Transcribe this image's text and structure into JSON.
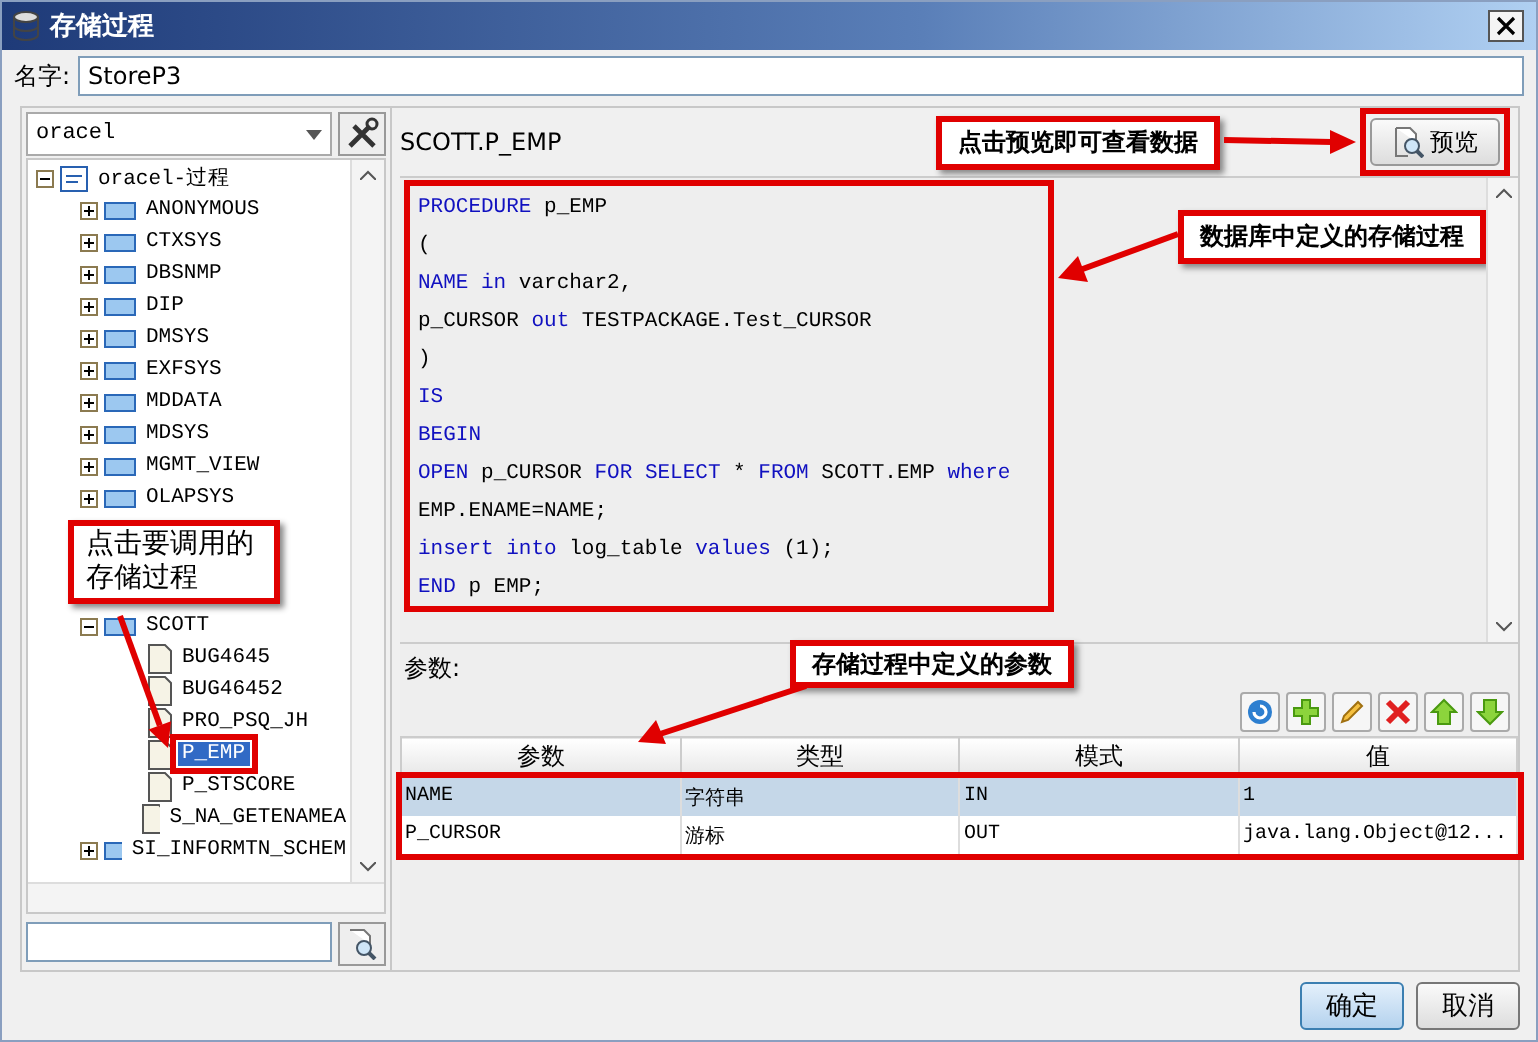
{
  "window": {
    "title": "存储过程"
  },
  "name_field": {
    "label": "名字:",
    "value": "StoreP3"
  },
  "connection_select": {
    "value": "oracel"
  },
  "tree": {
    "label": "oracel-过程",
    "expanded": true,
    "selected": false,
    "children": [
      {
        "kind": "schema",
        "label": "ANONYMOUS",
        "expanded": false,
        "selected": false
      },
      {
        "kind": "schema",
        "label": "CTXSYS",
        "expanded": false,
        "selected": false
      },
      {
        "kind": "schema",
        "label": "DBSNMP",
        "expanded": false,
        "selected": false
      },
      {
        "kind": "schema",
        "label": "DIP",
        "expanded": false,
        "selected": false
      },
      {
        "kind": "schema",
        "label": "DMSYS",
        "expanded": false,
        "selected": false
      },
      {
        "kind": "schema",
        "label": "EXFSYS",
        "expanded": false,
        "selected": false
      },
      {
        "kind": "schema",
        "label": "MDDATA",
        "expanded": false,
        "selected": false
      },
      {
        "kind": "schema",
        "label": "MDSYS",
        "expanded": false,
        "selected": false
      },
      {
        "kind": "schema",
        "label": "MGMT_VIEW",
        "expanded": false,
        "selected": false
      },
      {
        "kind": "schema",
        "label": "OLAPSYS",
        "expanded": false,
        "selected": false
      },
      {
        "kind": "note",
        "text": "点击要调用的存储过程"
      },
      {
        "kind": "schema",
        "label": "SCOTT",
        "expanded": true,
        "selected": false,
        "children": [
          {
            "kind": "procedure",
            "label": "BUG4645",
            "selected": false
          },
          {
            "kind": "procedure",
            "label": "BUG46452",
            "selected": false
          },
          {
            "kind": "procedure",
            "label": "PRO_PSQ_JH",
            "selected": false
          },
          {
            "kind": "procedure",
            "label": "P_EMP",
            "selected": true
          },
          {
            "kind": "procedure",
            "label": "P_STSCORE",
            "selected": false
          },
          {
            "kind": "procedure",
            "label": "S_NA_GETENAMEA",
            "selected": false
          }
        ]
      },
      {
        "kind": "schema",
        "label": "SI_INFORMTN_SCHEM",
        "expanded": false,
        "selected": false
      }
    ]
  },
  "procedure_header": {
    "title": "SCOTT.P_EMP",
    "note": "点击预览即可查看数据",
    "preview_button": "预览"
  },
  "code_note": "数据库中定义的存储过程",
  "code_lines": [
    [
      {
        "kind": "kw",
        "text": "PROCEDURE"
      },
      {
        "kind": "plain",
        "text": " p_EMP"
      }
    ],
    [
      {
        "kind": "plain",
        "text": "("
      }
    ],
    [
      {
        "kind": "kw",
        "text": "NAME in"
      },
      {
        "kind": "plain",
        "text": " varchar2,"
      }
    ],
    [
      {
        "kind": "plain",
        "text": "p_CURSOR "
      },
      {
        "kind": "kw",
        "text": "out"
      },
      {
        "kind": "plain",
        "text": " TESTPACKAGE.Test_CURSOR"
      }
    ],
    [
      {
        "kind": "plain",
        "text": ")"
      }
    ],
    [
      {
        "kind": "kw",
        "text": "IS"
      }
    ],
    [
      {
        "kind": "kw",
        "text": "BEGIN"
      }
    ],
    [
      {
        "kind": "kw",
        "text": "OPEN"
      },
      {
        "kind": "plain",
        "text": " p_CURSOR "
      },
      {
        "kind": "kw",
        "text": "FOR SELECT"
      },
      {
        "kind": "plain",
        "text": " * "
      },
      {
        "kind": "kw",
        "text": "FROM"
      },
      {
        "kind": "plain",
        "text": " SCOTT.EMP "
      },
      {
        "kind": "kw",
        "text": "where"
      }
    ],
    [
      {
        "kind": "plain",
        "text": "EMP.ENAME=NAME;"
      }
    ],
    [
      {
        "kind": "kw",
        "text": "insert into"
      },
      {
        "kind": "plain",
        "text": " log_table "
      },
      {
        "kind": "kw",
        "text": "values"
      },
      {
        "kind": "plain",
        "text": " (1);"
      }
    ],
    [
      {
        "kind": "kw",
        "text": "END"
      },
      {
        "kind": "plain",
        "text": " p EMP;"
      }
    ]
  ],
  "params": {
    "label": "参数:",
    "note": "存储过程中定义的参数",
    "toolbar": [
      {
        "kind": "refresh"
      },
      {
        "kind": "add"
      },
      {
        "kind": "edit"
      },
      {
        "kind": "delete"
      },
      {
        "kind": "up"
      },
      {
        "kind": "down"
      }
    ],
    "columns": [
      "参数",
      "类型",
      "模式",
      "值"
    ],
    "rows": [
      {
        "selected": true,
        "cells": [
          "NAME",
          "字符串",
          "IN",
          "1"
        ]
      },
      {
        "selected": false,
        "cells": [
          "P_CURSOR",
          "游标",
          "OUT",
          "java.lang.Object@12..."
        ]
      }
    ]
  },
  "buttons": [
    {
      "label": "确定",
      "kind": "default"
    },
    {
      "label": "取消",
      "kind": "normal"
    }
  ]
}
